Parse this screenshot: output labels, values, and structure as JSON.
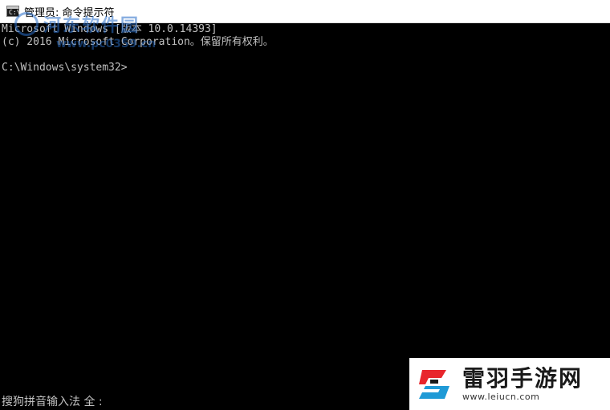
{
  "window": {
    "title": "管理员: 命令提示符",
    "icon_label": "C:\\"
  },
  "console": {
    "lines": [
      "Microsoft Windows [版本 10.0.14393]",
      "(c) 2016 Microsoft Corporation。保留所有权利。",
      "",
      "C:\\Windows\\system32>"
    ]
  },
  "ime_status": "搜狗拼音输入法 全 :",
  "watermarks": {
    "top_left": {
      "name": "河东软件园",
      "url": "www.pc0359.cn"
    },
    "bottom_right": {
      "name": "雷羽手游网",
      "url": "www.leiucn.com"
    }
  },
  "colors": {
    "console_bg": "#000000",
    "console_text": "#c0c0c0",
    "brand_red": "#e8262c",
    "brand_blue": "#1f9ad6"
  }
}
